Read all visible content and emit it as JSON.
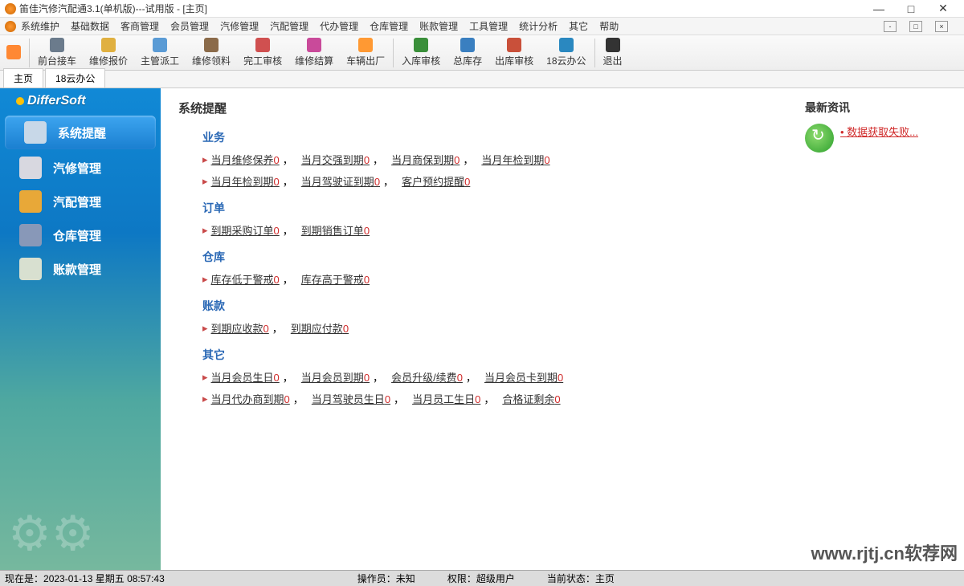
{
  "window": {
    "title": "笛佳汽修汽配通3.1(单机版)---试用版 - [主页]"
  },
  "menu": [
    "系统维护",
    "基础数据",
    "客商管理",
    "会员管理",
    "汽修管理",
    "汽配管理",
    "代办管理",
    "仓库管理",
    "账款管理",
    "工具管理",
    "统计分析",
    "其它",
    "帮助"
  ],
  "toolbar": [
    {
      "label": "",
      "color": "#ff8833"
    },
    {
      "label": "前台接车",
      "color": "#6b7b8c"
    },
    {
      "label": "维修报价",
      "color": "#e0b040"
    },
    {
      "label": "主管派工",
      "color": "#5a9bd5"
    },
    {
      "label": "维修领料",
      "color": "#8b6b4a"
    },
    {
      "label": "完工审核",
      "color": "#d05050"
    },
    {
      "label": "维修结算",
      "color": "#c94a9a"
    },
    {
      "label": "车辆出厂",
      "color": "#ff9933"
    },
    {
      "label": "入库审核",
      "color": "#3a8f3a"
    },
    {
      "label": "总库存",
      "color": "#3a7fc0"
    },
    {
      "label": "出库审核",
      "color": "#c9503a"
    },
    {
      "label": "18云办公",
      "color": "#2a88c0"
    },
    {
      "label": "退出",
      "color": "#333333"
    }
  ],
  "tabs": [
    "主页",
    "18云办公"
  ],
  "brand": "DifferSoft",
  "sidebar": [
    {
      "label": "系统提醒",
      "color": "#c8d8e8",
      "active": true
    },
    {
      "label": "汽修管理",
      "color": "#d8d8e0"
    },
    {
      "label": "汽配管理",
      "color": "#e8a838"
    },
    {
      "label": "仓库管理",
      "color": "#8898b8"
    },
    {
      "label": "账款管理",
      "color": "#d8e0d0"
    }
  ],
  "content": {
    "title": "系统提醒",
    "groups": [
      {
        "title": "业务",
        "rows": [
          [
            {
              "text": "当月维修保养",
              "n": "0"
            },
            {
              "text": "当月交强到期",
              "n": "0"
            },
            {
              "text": "当月商保到期",
              "n": "0"
            },
            {
              "text": "当月年检到期",
              "n": "0"
            }
          ],
          [
            {
              "text": "当月年检到期",
              "n": "0"
            },
            {
              "text": "当月驾驶证到期",
              "n": "0"
            },
            {
              "text": "客户预约提醒",
              "n": "0"
            }
          ]
        ]
      },
      {
        "title": "订单",
        "rows": [
          [
            {
              "text": "到期采购订单",
              "n": "0"
            },
            {
              "text": "到期销售订单",
              "n": "0"
            }
          ]
        ]
      },
      {
        "title": "仓库",
        "rows": [
          [
            {
              "text": "库存低于警戒",
              "n": "0"
            },
            {
              "text": "库存高于警戒",
              "n": "0"
            }
          ]
        ]
      },
      {
        "title": "账款",
        "rows": [
          [
            {
              "text": "到期应收款",
              "n": "0"
            },
            {
              "text": "到期应付款",
              "n": "0"
            }
          ]
        ]
      },
      {
        "title": "其它",
        "rows": [
          [
            {
              "text": "当月会员生日",
              "n": "0"
            },
            {
              "text": "当月会员到期",
              "n": "0"
            },
            {
              "text": "会员升级/续费",
              "n": "0"
            },
            {
              "text": "当月会员卡到期",
              "n": "0"
            }
          ],
          [
            {
              "text": "当月代办商到期",
              "n": "0"
            },
            {
              "text": "当月驾驶员生日",
              "n": "0"
            },
            {
              "text": "当月员工生日",
              "n": "0"
            },
            {
              "text": "合格证剩余",
              "n": "0"
            }
          ]
        ]
      }
    ]
  },
  "news": {
    "title": "最新资讯",
    "link": "数据获取失败..."
  },
  "status": {
    "now_label": "现在是：",
    "now": "2023-01-13 星期五 08:57:43",
    "op_label": "操作员：",
    "op": "未知",
    "perm_label": "权限：",
    "perm": "超级用户",
    "state_label": "当前状态：",
    "state": "主页"
  },
  "watermark": "www.rjtj.cn软荐网"
}
